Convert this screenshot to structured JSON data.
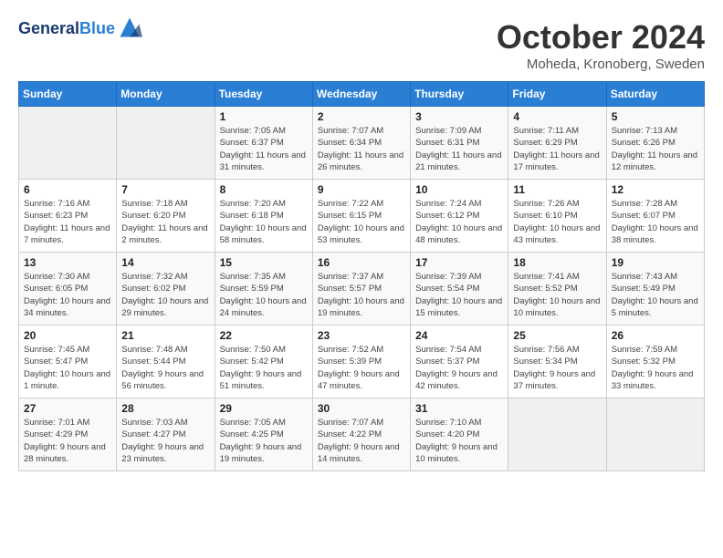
{
  "header": {
    "logo_line1": "General",
    "logo_line2": "Blue",
    "month_title": "October 2024",
    "location": "Moheda, Kronoberg, Sweden"
  },
  "weekdays": [
    "Sunday",
    "Monday",
    "Tuesday",
    "Wednesday",
    "Thursday",
    "Friday",
    "Saturday"
  ],
  "weeks": [
    [
      {
        "day": "",
        "sunrise": "",
        "sunset": "",
        "daylight": ""
      },
      {
        "day": "",
        "sunrise": "",
        "sunset": "",
        "daylight": ""
      },
      {
        "day": "1",
        "sunrise": "Sunrise: 7:05 AM",
        "sunset": "Sunset: 6:37 PM",
        "daylight": "Daylight: 11 hours and 31 minutes."
      },
      {
        "day": "2",
        "sunrise": "Sunrise: 7:07 AM",
        "sunset": "Sunset: 6:34 PM",
        "daylight": "Daylight: 11 hours and 26 minutes."
      },
      {
        "day": "3",
        "sunrise": "Sunrise: 7:09 AM",
        "sunset": "Sunset: 6:31 PM",
        "daylight": "Daylight: 11 hours and 21 minutes."
      },
      {
        "day": "4",
        "sunrise": "Sunrise: 7:11 AM",
        "sunset": "Sunset: 6:29 PM",
        "daylight": "Daylight: 11 hours and 17 minutes."
      },
      {
        "day": "5",
        "sunrise": "Sunrise: 7:13 AM",
        "sunset": "Sunset: 6:26 PM",
        "daylight": "Daylight: 11 hours and 12 minutes."
      }
    ],
    [
      {
        "day": "6",
        "sunrise": "Sunrise: 7:16 AM",
        "sunset": "Sunset: 6:23 PM",
        "daylight": "Daylight: 11 hours and 7 minutes."
      },
      {
        "day": "7",
        "sunrise": "Sunrise: 7:18 AM",
        "sunset": "Sunset: 6:20 PM",
        "daylight": "Daylight: 11 hours and 2 minutes."
      },
      {
        "day": "8",
        "sunrise": "Sunrise: 7:20 AM",
        "sunset": "Sunset: 6:18 PM",
        "daylight": "Daylight: 10 hours and 58 minutes."
      },
      {
        "day": "9",
        "sunrise": "Sunrise: 7:22 AM",
        "sunset": "Sunset: 6:15 PM",
        "daylight": "Daylight: 10 hours and 53 minutes."
      },
      {
        "day": "10",
        "sunrise": "Sunrise: 7:24 AM",
        "sunset": "Sunset: 6:12 PM",
        "daylight": "Daylight: 10 hours and 48 minutes."
      },
      {
        "day": "11",
        "sunrise": "Sunrise: 7:26 AM",
        "sunset": "Sunset: 6:10 PM",
        "daylight": "Daylight: 10 hours and 43 minutes."
      },
      {
        "day": "12",
        "sunrise": "Sunrise: 7:28 AM",
        "sunset": "Sunset: 6:07 PM",
        "daylight": "Daylight: 10 hours and 38 minutes."
      }
    ],
    [
      {
        "day": "13",
        "sunrise": "Sunrise: 7:30 AM",
        "sunset": "Sunset: 6:05 PM",
        "daylight": "Daylight: 10 hours and 34 minutes."
      },
      {
        "day": "14",
        "sunrise": "Sunrise: 7:32 AM",
        "sunset": "Sunset: 6:02 PM",
        "daylight": "Daylight: 10 hours and 29 minutes."
      },
      {
        "day": "15",
        "sunrise": "Sunrise: 7:35 AM",
        "sunset": "Sunset: 5:59 PM",
        "daylight": "Daylight: 10 hours and 24 minutes."
      },
      {
        "day": "16",
        "sunrise": "Sunrise: 7:37 AM",
        "sunset": "Sunset: 5:57 PM",
        "daylight": "Daylight: 10 hours and 19 minutes."
      },
      {
        "day": "17",
        "sunrise": "Sunrise: 7:39 AM",
        "sunset": "Sunset: 5:54 PM",
        "daylight": "Daylight: 10 hours and 15 minutes."
      },
      {
        "day": "18",
        "sunrise": "Sunrise: 7:41 AM",
        "sunset": "Sunset: 5:52 PM",
        "daylight": "Daylight: 10 hours and 10 minutes."
      },
      {
        "day": "19",
        "sunrise": "Sunrise: 7:43 AM",
        "sunset": "Sunset: 5:49 PM",
        "daylight": "Daylight: 10 hours and 5 minutes."
      }
    ],
    [
      {
        "day": "20",
        "sunrise": "Sunrise: 7:45 AM",
        "sunset": "Sunset: 5:47 PM",
        "daylight": "Daylight: 10 hours and 1 minute."
      },
      {
        "day": "21",
        "sunrise": "Sunrise: 7:48 AM",
        "sunset": "Sunset: 5:44 PM",
        "daylight": "Daylight: 9 hours and 56 minutes."
      },
      {
        "day": "22",
        "sunrise": "Sunrise: 7:50 AM",
        "sunset": "Sunset: 5:42 PM",
        "daylight": "Daylight: 9 hours and 51 minutes."
      },
      {
        "day": "23",
        "sunrise": "Sunrise: 7:52 AM",
        "sunset": "Sunset: 5:39 PM",
        "daylight": "Daylight: 9 hours and 47 minutes."
      },
      {
        "day": "24",
        "sunrise": "Sunrise: 7:54 AM",
        "sunset": "Sunset: 5:37 PM",
        "daylight": "Daylight: 9 hours and 42 minutes."
      },
      {
        "day": "25",
        "sunrise": "Sunrise: 7:56 AM",
        "sunset": "Sunset: 5:34 PM",
        "daylight": "Daylight: 9 hours and 37 minutes."
      },
      {
        "day": "26",
        "sunrise": "Sunrise: 7:59 AM",
        "sunset": "Sunset: 5:32 PM",
        "daylight": "Daylight: 9 hours and 33 minutes."
      }
    ],
    [
      {
        "day": "27",
        "sunrise": "Sunrise: 7:01 AM",
        "sunset": "Sunset: 4:29 PM",
        "daylight": "Daylight: 9 hours and 28 minutes."
      },
      {
        "day": "28",
        "sunrise": "Sunrise: 7:03 AM",
        "sunset": "Sunset: 4:27 PM",
        "daylight": "Daylight: 9 hours and 23 minutes."
      },
      {
        "day": "29",
        "sunrise": "Sunrise: 7:05 AM",
        "sunset": "Sunset: 4:25 PM",
        "daylight": "Daylight: 9 hours and 19 minutes."
      },
      {
        "day": "30",
        "sunrise": "Sunrise: 7:07 AM",
        "sunset": "Sunset: 4:22 PM",
        "daylight": "Daylight: 9 hours and 14 minutes."
      },
      {
        "day": "31",
        "sunrise": "Sunrise: 7:10 AM",
        "sunset": "Sunset: 4:20 PM",
        "daylight": "Daylight: 9 hours and 10 minutes."
      },
      {
        "day": "",
        "sunrise": "",
        "sunset": "",
        "daylight": ""
      },
      {
        "day": "",
        "sunrise": "",
        "sunset": "",
        "daylight": ""
      }
    ]
  ]
}
